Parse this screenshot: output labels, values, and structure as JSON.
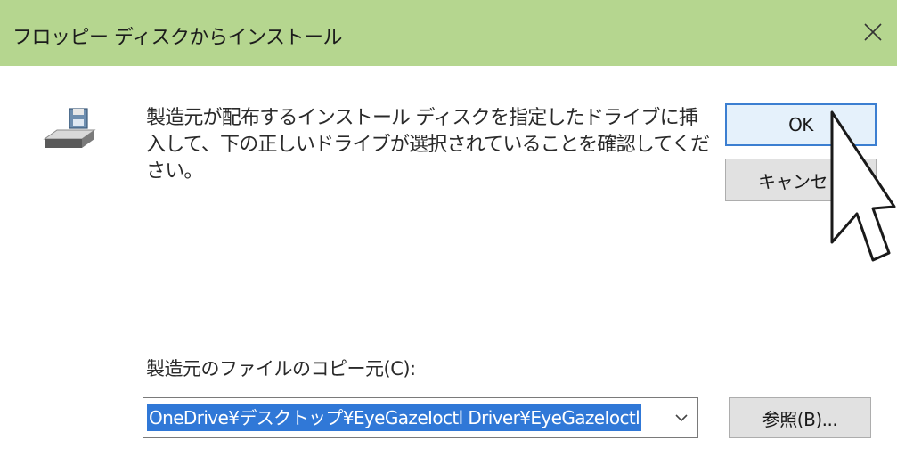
{
  "window": {
    "title": "フロッピー ディスクからインストール",
    "close_label": "✕"
  },
  "icons": {
    "disk": "floppy-drive-icon",
    "close": "close-icon",
    "dropdown": "chevron-down-icon",
    "cursor": "mouse-pointer-icon"
  },
  "message": "製造元が配布するインストール ディスクを指定したドライブに挿入して、下の正しいドライブが選択されていることを確認してください。",
  "buttons": {
    "ok": "OK",
    "cancel": "キャンセ",
    "browse": "参照(B)..."
  },
  "copy_from": {
    "label": "製造元のファイルのコピー元(C):",
    "value": "OneDrive¥デスクトップ¥EyeGazeIoctl Driver¥EyeGazeIoctl"
  },
  "colors": {
    "titlebar": "#b5d68f",
    "selection": "#3078d7",
    "focus_border": "#3c7fd1"
  }
}
